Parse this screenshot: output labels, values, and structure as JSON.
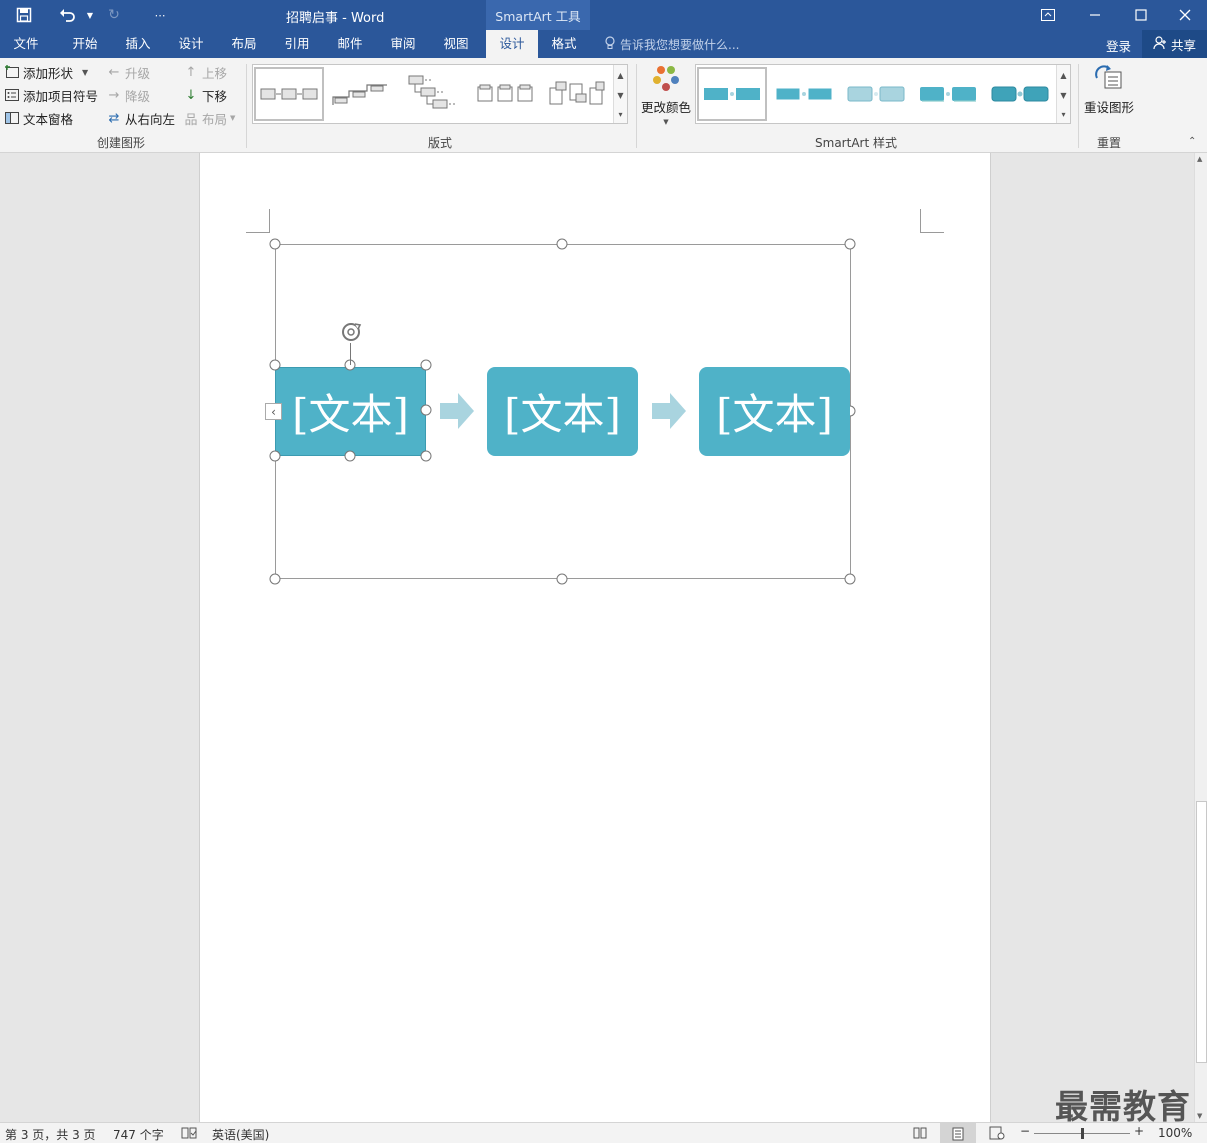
{
  "titlebar": {
    "document_title": "招聘启事 - Word",
    "context_title": "SmartArt 工具",
    "qa_customize": "⋯"
  },
  "tabs": [
    {
      "label": "文件",
      "active": false
    },
    {
      "label": "开始",
      "active": false
    },
    {
      "label": "插入",
      "active": false
    },
    {
      "label": "设计",
      "active": false
    },
    {
      "label": "布局",
      "active": false
    },
    {
      "label": "引用",
      "active": false
    },
    {
      "label": "邮件",
      "active": false
    },
    {
      "label": "审阅",
      "active": false
    },
    {
      "label": "视图",
      "active": false
    },
    {
      "label": "设计",
      "active": true
    },
    {
      "label": "格式",
      "active": false
    }
  ],
  "tellme_placeholder": "告诉我您想要做什么...",
  "login_label": "登录",
  "share_label": "共享",
  "ribbon": {
    "create_group": {
      "label": "创建图形",
      "add_shape": "添加形状",
      "add_bullet": "添加项目符号",
      "text_pane": "文本窗格",
      "promote": "升级",
      "demote": "降级",
      "right_to_left": "从右向左",
      "move_up": "上移",
      "move_down": "下移",
      "layout": "布局"
    },
    "layouts_group": {
      "label": "版式"
    },
    "styles_group": {
      "label": "SmartArt 样式",
      "change_colors": "更改颜色"
    },
    "reset_group": {
      "label": "重置",
      "reset_graphic": "重设图形"
    }
  },
  "smartart": {
    "boxes": [
      "[文本]",
      "[文本]",
      "[文本]"
    ],
    "box_color": "#4fb2c8",
    "arrow_color": "#a9d4df"
  },
  "statusbar": {
    "page_info": "第 3 页，共 3 页",
    "word_count": "747 个字",
    "language": "英语(美国)",
    "zoom": "100%",
    "zoom_level": 1.0
  },
  "watermark": "最需教育",
  "colors": {
    "brand": "#2b579a",
    "ribbon_bg": "#f3f3f3"
  }
}
